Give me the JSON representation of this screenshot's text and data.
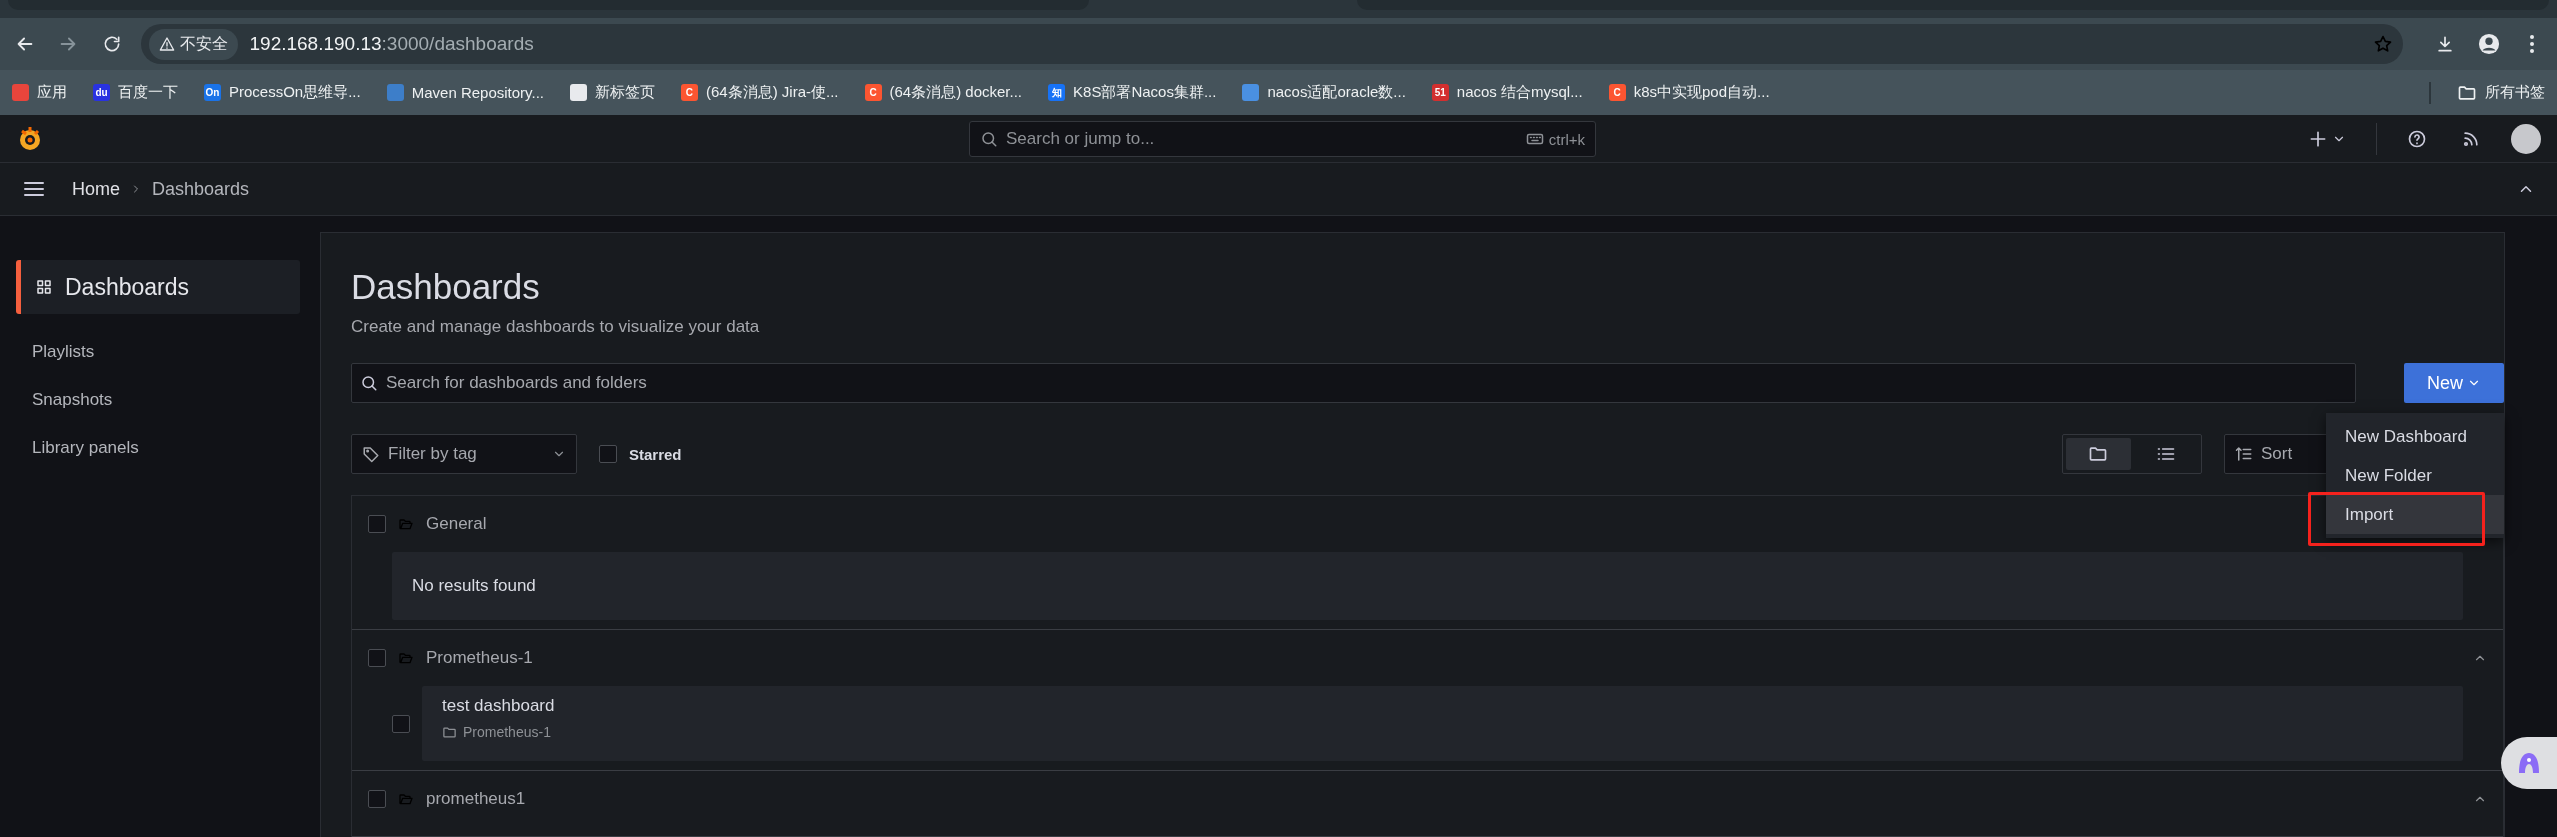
{
  "browser": {
    "address": {
      "security_label": "不安全",
      "host": "192.168.190.13",
      "path": ":3000/dashboards"
    },
    "bookmarks": [
      {
        "label": "应用",
        "color": "#e8453c"
      },
      {
        "label": "百度一下",
        "badge": "du",
        "color": "#2932e1"
      },
      {
        "label": "ProcessOn思维导...",
        "badge": "On",
        "color": "#1a73e8"
      },
      {
        "label": "Maven Repository...",
        "color": "#3d7ec9"
      },
      {
        "label": "新标签页",
        "color": "#e8eaed"
      },
      {
        "label": "(64条消息) Jira-使...",
        "badge": "C",
        "color": "#fc5531"
      },
      {
        "label": "(64条消息) docker...",
        "badge": "C",
        "color": "#fc5531"
      },
      {
        "label": "K8S部署Nacos集群...",
        "badge": "知",
        "color": "#1772f6"
      },
      {
        "label": "nacos适配oracle数...",
        "color": "#4a90e2"
      },
      {
        "label": "nacos 结合mysql...",
        "badge": "51",
        "color": "#d32f2f"
      },
      {
        "label": "k8s中实现pod自动...",
        "badge": "C",
        "color": "#fc5531"
      }
    ],
    "all_bookmarks": "所有书签"
  },
  "topbar": {
    "search_placeholder": "Search or jump to...",
    "shortcut": "ctrl+k"
  },
  "breadcrumb": [
    "Home",
    "Dashboards"
  ],
  "sidebar": {
    "items": [
      {
        "label": "Dashboards",
        "selected": true
      },
      {
        "label": "Playlists",
        "selected": false
      },
      {
        "label": "Snapshots",
        "selected": false
      },
      {
        "label": "Library panels",
        "selected": false
      }
    ]
  },
  "page": {
    "title": "Dashboards",
    "subtitle": "Create and manage dashboards to visualize your data",
    "search_placeholder": "Search for dashboards and folders",
    "new_button": "New",
    "new_menu": [
      {
        "label": "New Dashboard",
        "selected": false,
        "highlighted": false
      },
      {
        "label": "New Folder",
        "selected": false,
        "highlighted": false
      },
      {
        "label": "Import",
        "selected": true,
        "highlighted": true
      }
    ],
    "tag_filter_placeholder": "Filter by tag",
    "starred": {
      "label": "Starred",
      "checked": false
    },
    "views": [
      {
        "kind": "folders",
        "selected": true
      },
      {
        "kind": "list",
        "selected": false
      }
    ],
    "sort_placeholder": "Sort",
    "folders": [
      {
        "name": "General",
        "checked": false,
        "empty_text": "No results found"
      },
      {
        "name": "Prometheus-1",
        "checked": false,
        "expanded": true,
        "items": [
          {
            "title": "test dashboard",
            "folder": "Prometheus-1",
            "checked": false
          }
        ]
      },
      {
        "name": "prometheus1",
        "checked": false,
        "expanded": true
      }
    ]
  }
}
